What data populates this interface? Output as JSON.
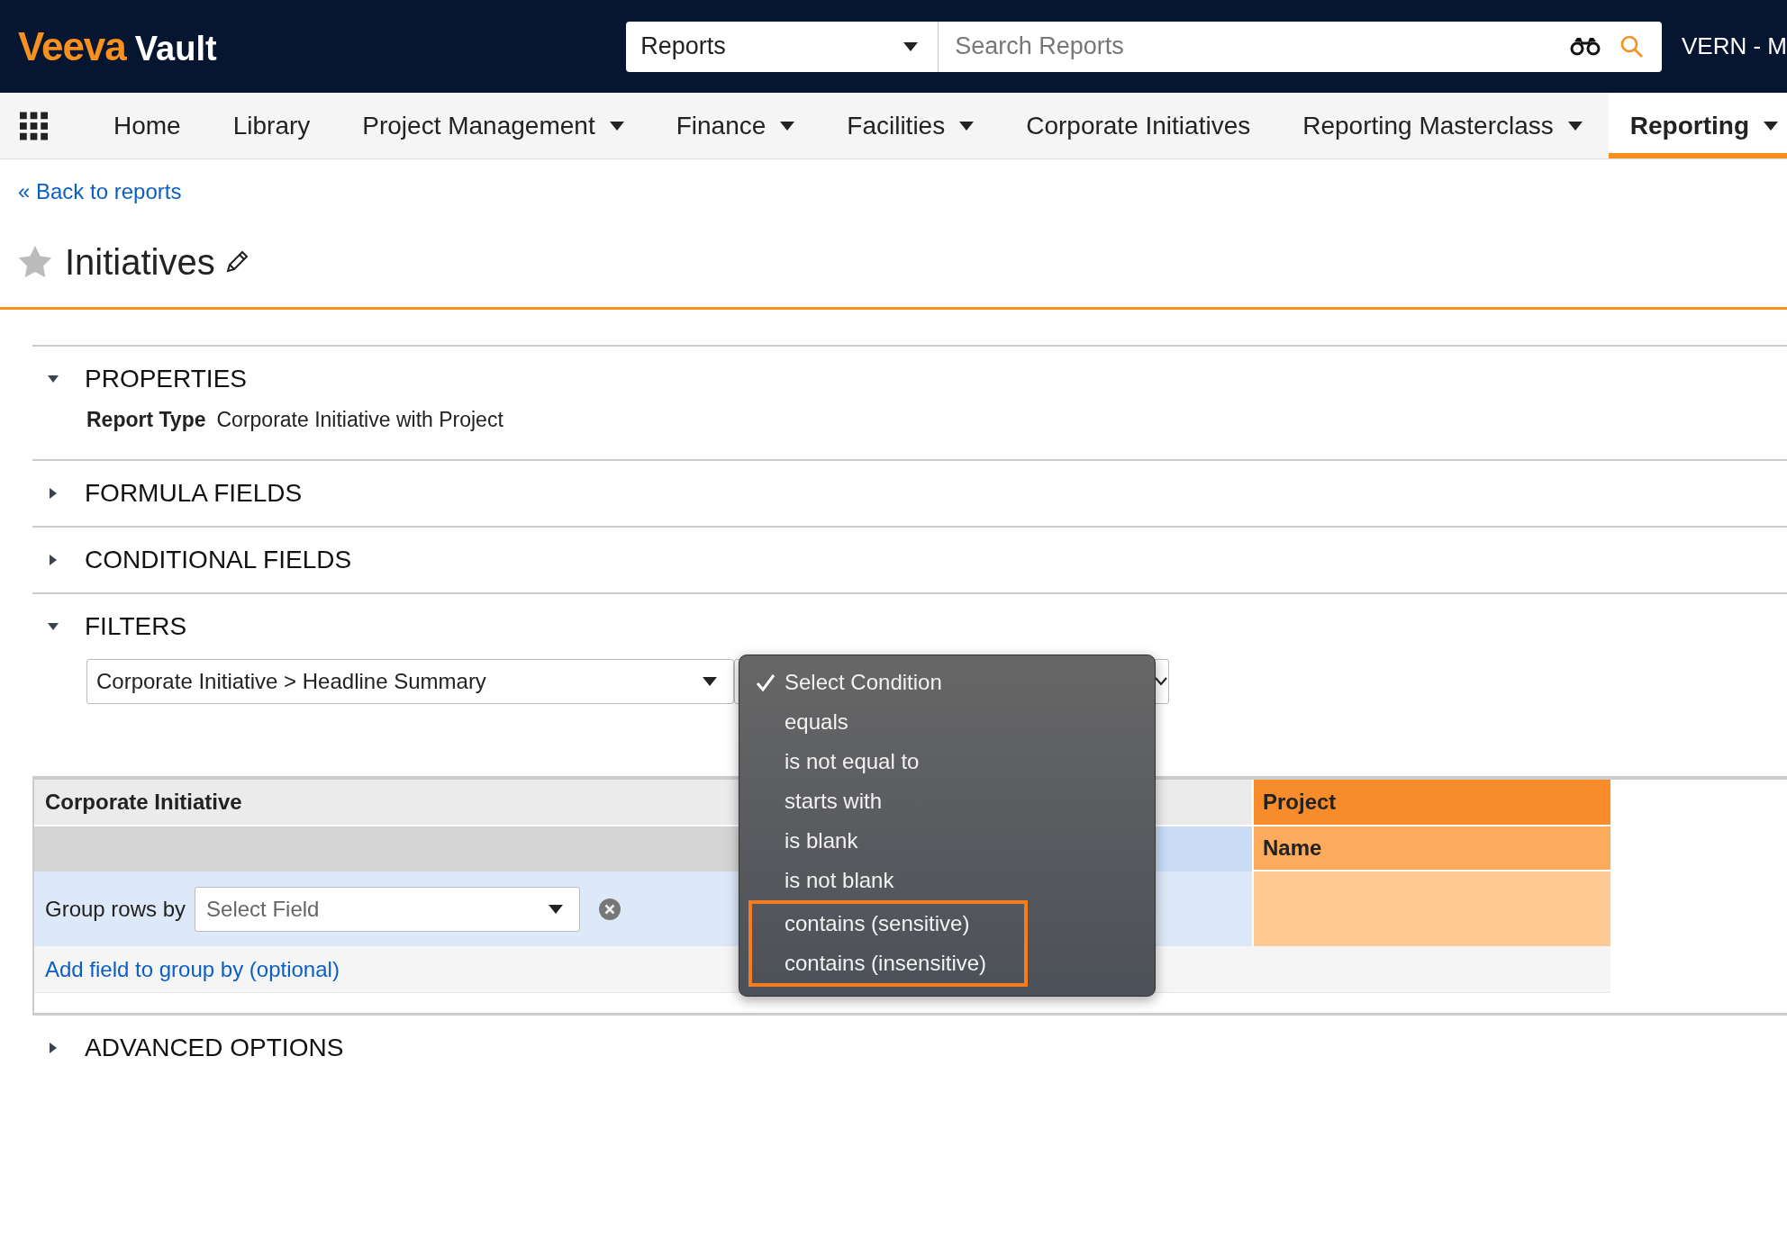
{
  "header": {
    "logo_brand": "Veeva",
    "logo_product": "Vault",
    "search_scope": "Reports",
    "search": {
      "placeholder": "Search Reports"
    },
    "user": "VERN - M"
  },
  "nav": {
    "items": [
      {
        "label": "Home",
        "has_menu": false,
        "selected": false
      },
      {
        "label": "Library",
        "has_menu": false,
        "selected": false
      },
      {
        "label": "Project Management",
        "has_menu": true,
        "selected": false
      },
      {
        "label": "Finance",
        "has_menu": true,
        "selected": false
      },
      {
        "label": "Facilities",
        "has_menu": true,
        "selected": false
      },
      {
        "label": "Corporate Initiatives",
        "has_menu": false,
        "selected": false
      },
      {
        "label": "Reporting Masterclass",
        "has_menu": true,
        "selected": false
      },
      {
        "label": "Reporting",
        "has_menu": true,
        "selected": true
      }
    ]
  },
  "back_link": "« Back to reports",
  "page": {
    "title": "Initiatives",
    "favorite": false
  },
  "sections": [
    {
      "kind": "properties",
      "title": "PROPERTIES",
      "expanded": true,
      "properties": [
        {
          "label": "Report Type",
          "value": "Corporate Initiative with Project"
        }
      ]
    },
    {
      "kind": "plain",
      "title": "FORMULA FIELDS",
      "expanded": false
    },
    {
      "kind": "plain",
      "title": "CONDITIONAL FIELDS",
      "expanded": false
    },
    {
      "kind": "filters",
      "title": "FILTERS",
      "expanded": true,
      "filter": {
        "field": "Corporate Initiative > Headline Summary",
        "condition_menu": [
          {
            "label": "Select Condition",
            "selected": true,
            "highlighted": false
          },
          {
            "label": "equals",
            "selected": false,
            "highlighted": false
          },
          {
            "label": "is not equal to",
            "selected": false,
            "highlighted": false
          },
          {
            "label": "starts with",
            "selected": false,
            "highlighted": false
          },
          {
            "label": "is blank",
            "selected": false,
            "highlighted": false
          },
          {
            "label": "is not blank",
            "selected": false,
            "highlighted": false
          },
          {
            "label": "contains (sensitive)",
            "selected": false,
            "highlighted": true
          },
          {
            "label": "contains (insensitive)",
            "selected": false,
            "highlighted": true
          }
        ]
      }
    },
    {
      "kind": "layout",
      "groups": [
        {
          "kind": "primary",
          "title": "Corporate Initiative"
        },
        {
          "kind": "related",
          "title": "Project",
          "column": "Name"
        }
      ],
      "group_by": {
        "label": "Group rows by",
        "placeholder": "Select Field"
      },
      "add_link": "Add field to group by (optional)"
    },
    {
      "kind": "plain",
      "title": "ADVANCED OPTIONS",
      "expanded": false
    }
  ]
}
